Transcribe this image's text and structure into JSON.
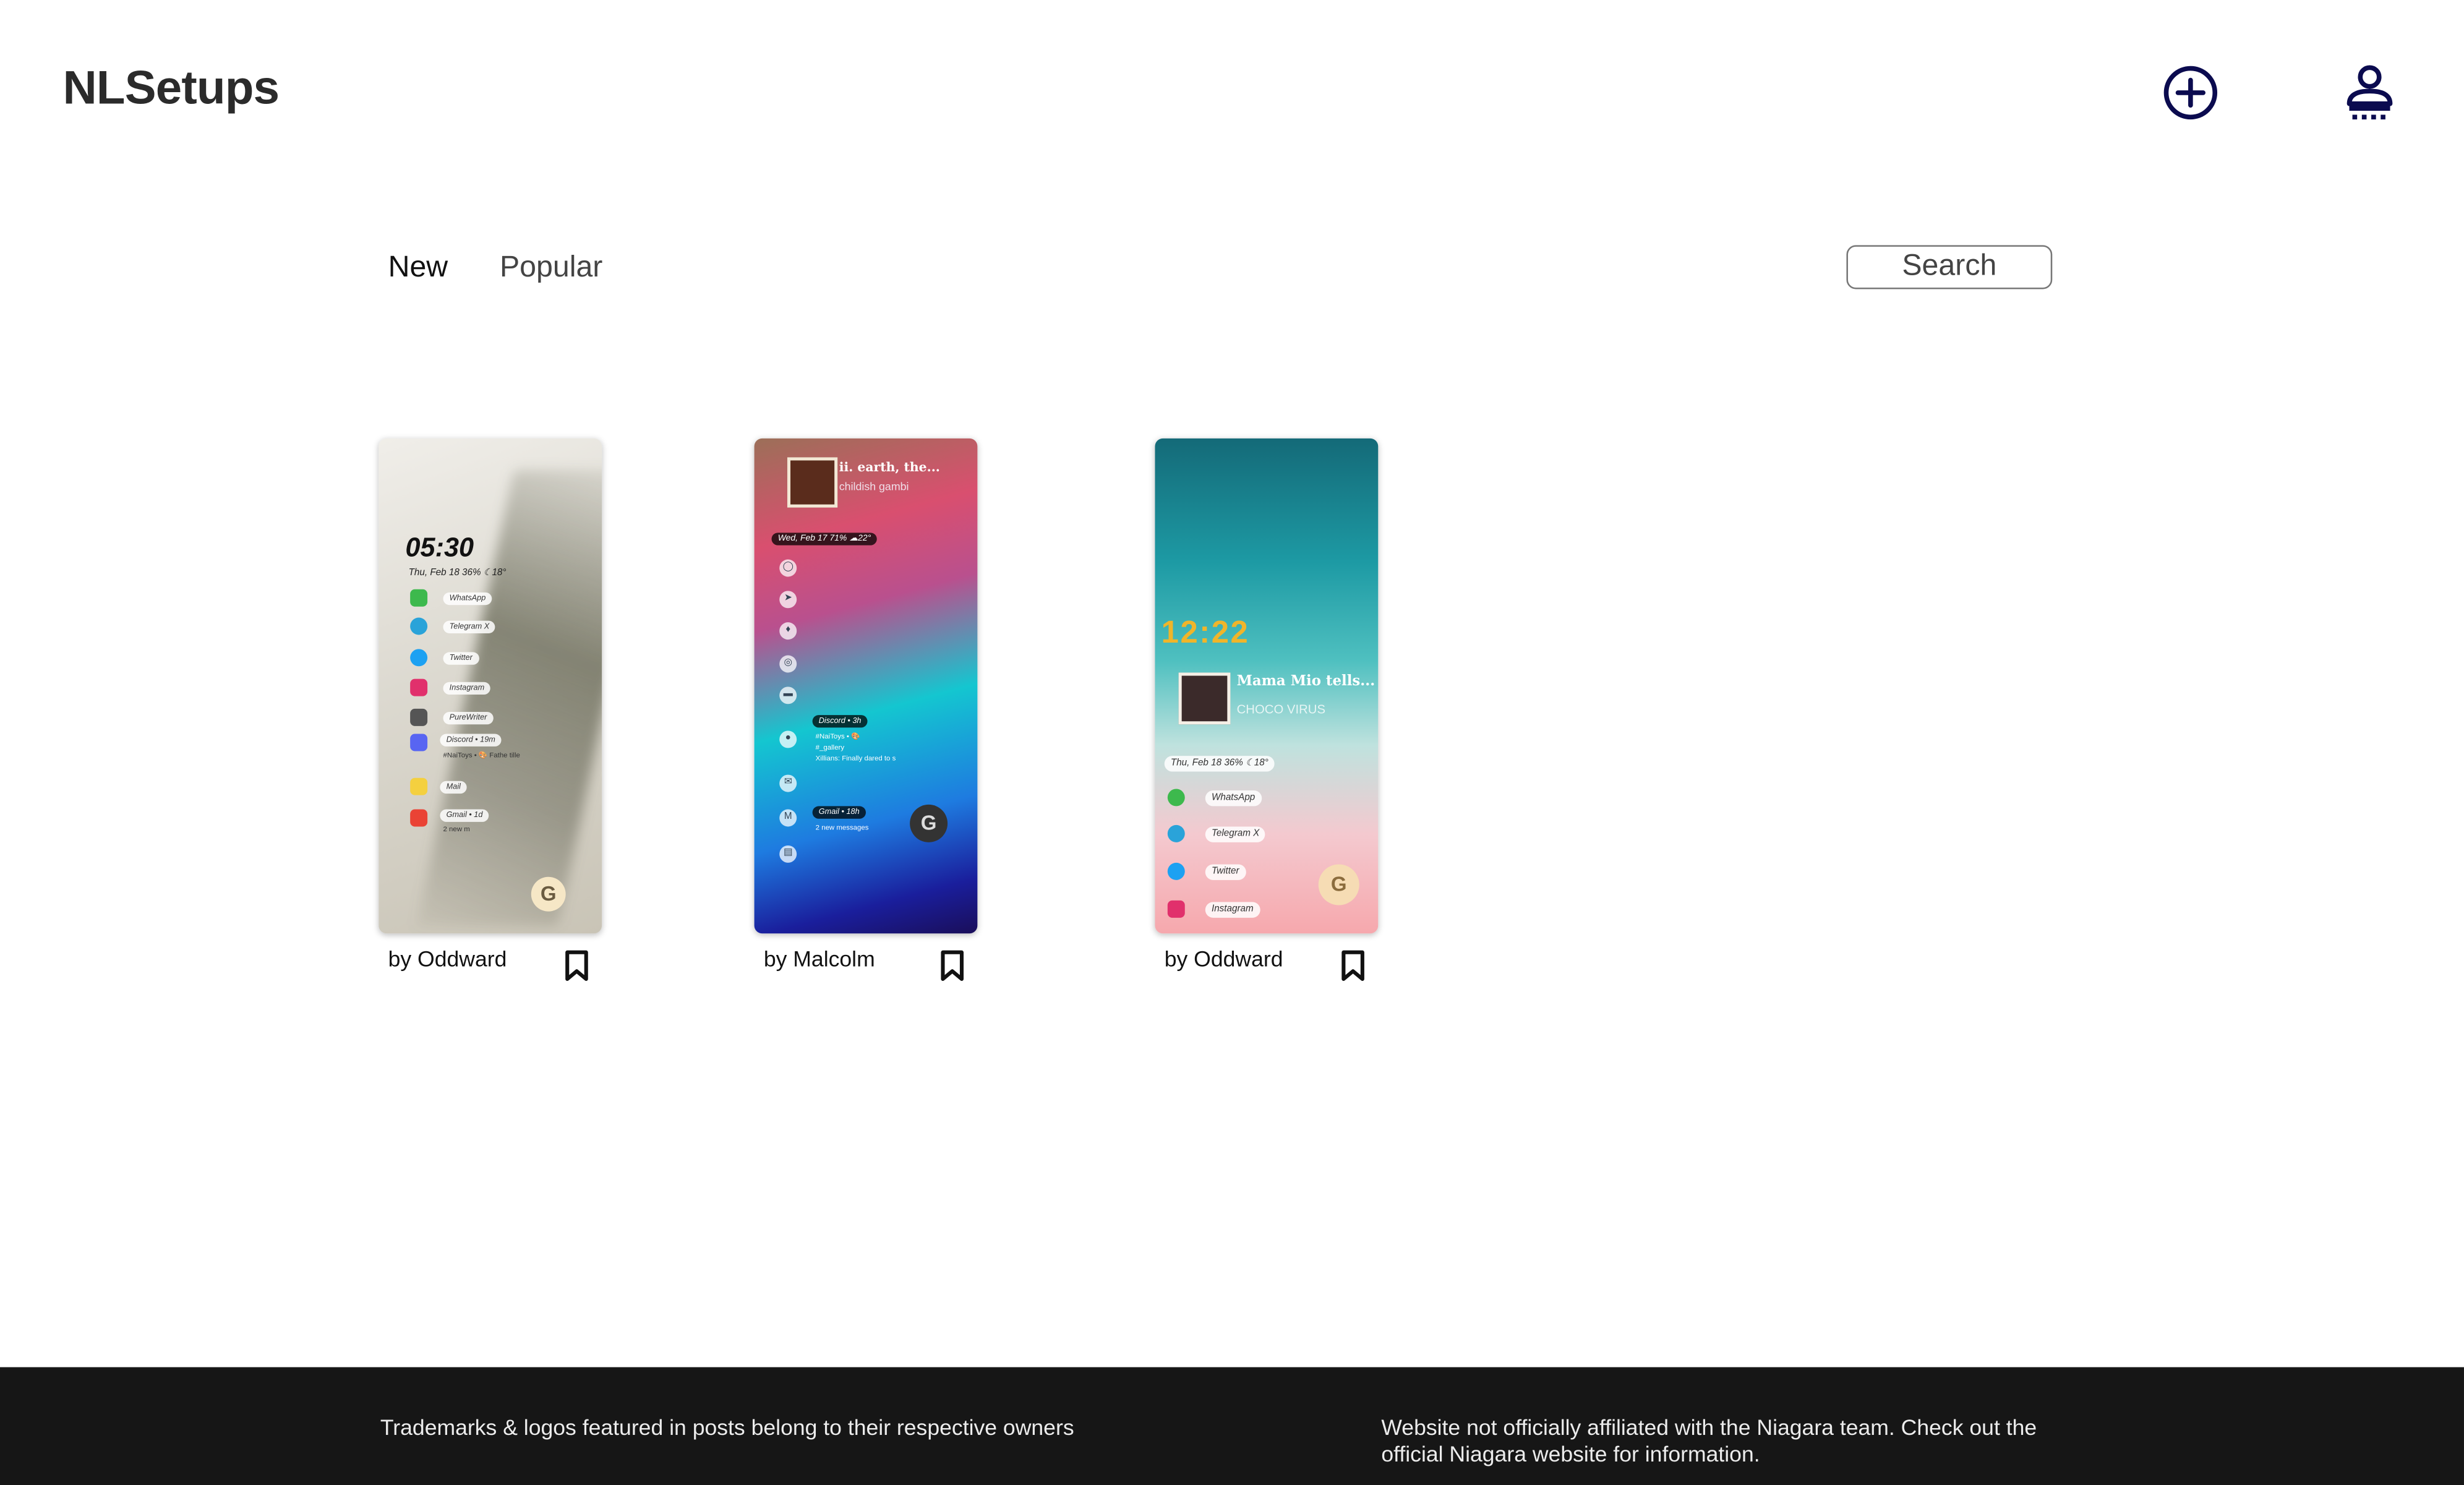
{
  "header": {
    "logo": "NLSetups",
    "icons": [
      "add-circle-icon",
      "user-account-icon"
    ],
    "accent_color": "#0b0b4f"
  },
  "tabs": [
    {
      "label": "New",
      "active": true
    },
    {
      "label": "Popular",
      "active": false
    }
  ],
  "search": {
    "placeholder": "Search"
  },
  "posts": [
    {
      "author": "by Oddward",
      "preview": {
        "clock": "05:30",
        "info": "Thu, Feb 18  36%  ☾18°",
        "apps": [
          "WhatsApp",
          "Telegram X",
          "Twitter",
          "Instagram",
          "PureWriter",
          "Discord • 19m",
          "Mail",
          "Gmail • 1d"
        ],
        "discord_sub": "#NaiToys • 🎨  Fathe tille",
        "gmail_sub": "2 new m",
        "search_glyph": "G"
      }
    },
    {
      "author": "by Malcolm",
      "preview": {
        "music_title": "ii. earth, the...",
        "music_artist": "childish gambi",
        "info": "Wed, Feb 17  71%  ☁22°",
        "discord": "Discord • 3h",
        "discord_sub1": "#NaiToys • 🎨",
        "discord_sub2": "#_gallery",
        "discord_sub3": "Xillians: Finally dared to s",
        "gmail": "Gmail • 18h",
        "gmail_sub": "2 new messages",
        "search_glyph": "G"
      }
    },
    {
      "author": "by Oddward",
      "preview": {
        "clock": "12:22",
        "music_title": "Mama Mio tells...",
        "music_artist": "CHOCO VIRUS",
        "info": "Thu, Feb 18  36%  ☾18°",
        "apps": [
          "WhatsApp",
          "Telegram X",
          "Twitter",
          "Instagram"
        ],
        "search_glyph": "G"
      }
    }
  ],
  "footer": {
    "left": "Trademarks & logos featured in posts belong to their respective owners",
    "right": "Website not officially affiliated with the Niagara team. Check out the official Niagara website for information."
  }
}
